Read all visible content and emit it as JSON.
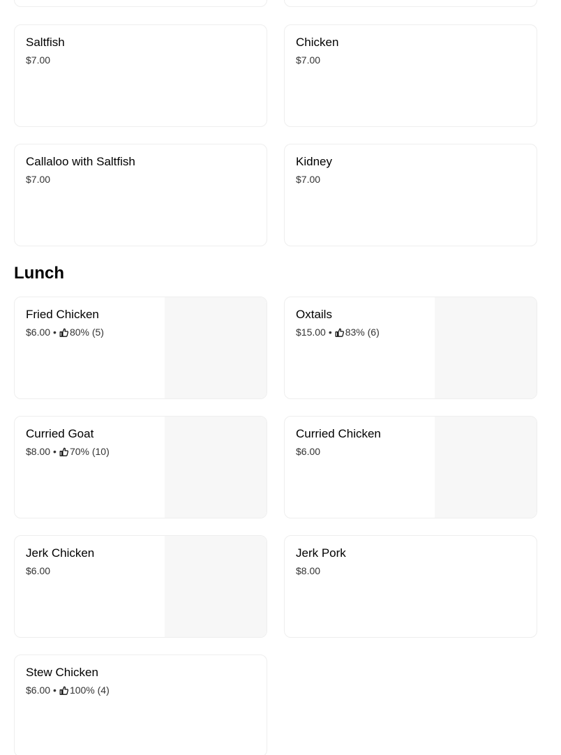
{
  "top_cards": [
    {
      "name": "",
      "price": ""
    },
    {
      "name": "",
      "price": ""
    }
  ],
  "breakfast_items": [
    {
      "name": "Saltfish",
      "price": "$7.00"
    },
    {
      "name": "Chicken",
      "price": "$7.00"
    },
    {
      "name": "Callaloo with Saltfish",
      "price": "$7.00"
    },
    {
      "name": "Kidney",
      "price": "$7.00"
    }
  ],
  "lunch": {
    "title": "Lunch",
    "items": [
      {
        "name": "Fried Chicken",
        "price": "$6.00",
        "rating": "80% (5)",
        "separator": "•",
        "rating_icon": "thumbs-up-icon"
      },
      {
        "name": "Oxtails",
        "price": "$15.00",
        "rating": "83% (6)",
        "separator": "•",
        "rating_icon": "thumbs-up-icon"
      },
      {
        "name": "Curried Goat",
        "price": "$8.00",
        "rating": "70% (10)",
        "separator": "•",
        "rating_icon": "thumbs-up-icon"
      },
      {
        "name": "Curried Chicken",
        "price": "$6.00"
      },
      {
        "name": "Jerk Chicken",
        "price": "$6.00"
      },
      {
        "name": "Jerk Pork",
        "price": "$8.00"
      },
      {
        "name": "Stew Chicken",
        "price": "$6.00",
        "rating": "100% (4)",
        "separator": "•",
        "rating_icon": "thumbs-up-icon"
      }
    ]
  },
  "colors": {
    "card_border": "#eeeeee",
    "image_placeholder": "#f7f7f7",
    "text": "#000000"
  }
}
